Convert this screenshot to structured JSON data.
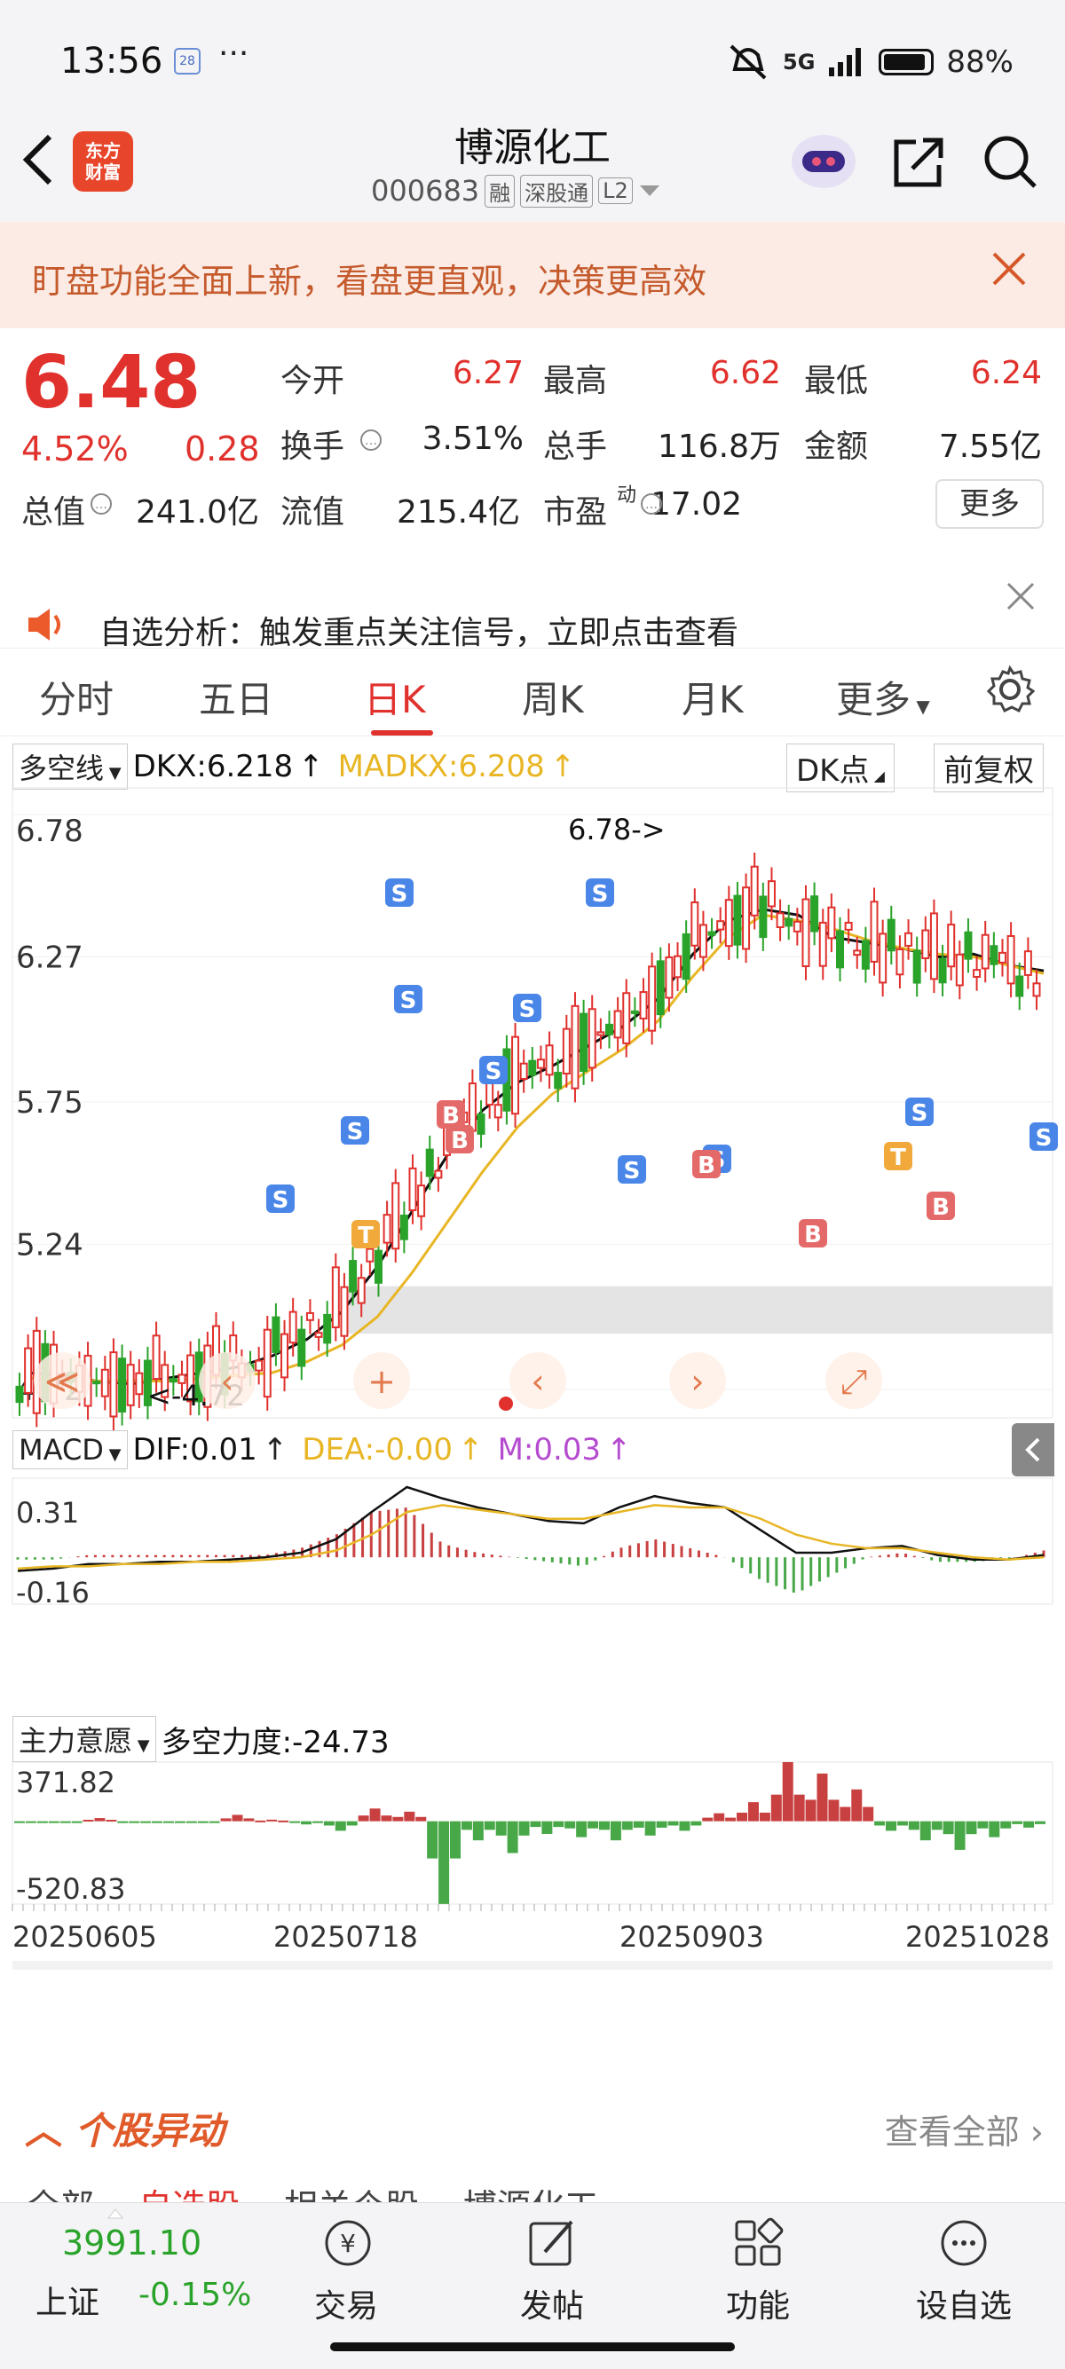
{
  "status_bar": {
    "time": "13:56",
    "notif": "28",
    "dots": "···",
    "network": "5G",
    "battery": "88%",
    "battery_level": 0.88
  },
  "header": {
    "stock_name": "博源化工",
    "stock_code": "000683",
    "tags": [
      "融",
      "深股通",
      "L2"
    ],
    "logo": "东方财富"
  },
  "banner": {
    "text": "盯盘功能全面上新，看盘更直观，决策更高效"
  },
  "quote": {
    "price": "6.48",
    "change_pct": "4.52%",
    "change": "0.28",
    "fields": [
      {
        "label": "今开",
        "value": "6.27",
        "color": "#e0312d"
      },
      {
        "label": "最高",
        "value": "6.62",
        "color": "#e0312d"
      },
      {
        "label": "最低",
        "value": "6.24",
        "color": "#e0312d"
      },
      {
        "label": "换手",
        "value": "3.51%",
        "color": "#222"
      },
      {
        "label": "总手",
        "value": "116.8万",
        "color": "#222"
      },
      {
        "label": "金额",
        "value": "7.55亿",
        "color": "#222"
      },
      {
        "label": "总值",
        "value": "241.0亿",
        "color": "#222"
      },
      {
        "label": "流值",
        "value": "215.4亿",
        "color": "#222"
      },
      {
        "label": "市盈",
        "value": "17.02",
        "color": "#222"
      }
    ],
    "pe_superscript": "动",
    "more": "更多"
  },
  "alert": {
    "text": "自选分析：触发重点关注信号，立即点击查看"
  },
  "tabs": [
    "分时",
    "五日",
    "日K",
    "周K",
    "月K",
    "更多"
  ],
  "active_tab": "日K",
  "kline_header": {
    "selector": "多空线",
    "dkx": "DKX:6.218",
    "madkx": "MADKX:6.208",
    "dk_point": "DK点",
    "adjust": "前复权"
  },
  "macd_header": {
    "selector": "MACD",
    "dif": "DIF:0.01",
    "dea": "DEA:-0.00",
    "m": "M:0.03"
  },
  "flow_header": {
    "selector": "主力意愿",
    "power": "多空力度:-24.73"
  },
  "chart_data": [
    {
      "type": "candlestick",
      "title": "日K",
      "y_ticks": [
        "6.78",
        "6.27",
        "5.75",
        "5.24",
        "4.72"
      ],
      "ylim": [
        4.72,
        6.78
      ],
      "annotations": [
        "6.78->",
        "<-4.72"
      ],
      "series": [
        {
          "name": "DKX",
          "color": "#111111",
          "values": [
            4.78,
            4.77,
            4.75,
            4.74,
            4.76,
            4.78,
            4.8,
            4.84,
            4.9,
            5.0,
            5.16,
            5.36,
            5.56,
            5.72,
            5.82,
            5.88,
            5.95,
            6.02,
            6.12,
            6.28,
            6.4,
            6.44,
            6.42,
            6.34,
            6.32,
            6.3,
            6.27,
            6.28,
            6.24,
            6.22
          ]
        },
        {
          "name": "MADKX",
          "color": "#e8b625",
          "values": [
            4.76,
            4.76,
            4.75,
            4.75,
            4.75,
            4.76,
            4.77,
            4.78,
            4.82,
            4.88,
            4.98,
            5.14,
            5.32,
            5.5,
            5.66,
            5.78,
            5.86,
            5.94,
            6.04,
            6.2,
            6.34,
            6.42,
            6.4,
            6.37,
            6.33,
            6.3,
            6.28,
            6.27,
            6.24,
            6.21
          ]
        }
      ]
    },
    {
      "type": "bar",
      "title": "MACD",
      "y_ticks": [
        "0.31",
        "-0.16"
      ],
      "ylim": [
        -0.16,
        0.31
      ],
      "series": [
        {
          "name": "DIF",
          "color": "#111111",
          "values": [
            -0.06,
            -0.05,
            -0.03,
            -0.03,
            -0.02,
            -0.02,
            -0.01,
            0.0,
            0.02,
            0.08,
            0.2,
            0.31,
            0.26,
            0.22,
            0.19,
            0.16,
            0.15,
            0.22,
            0.27,
            0.24,
            0.22,
            0.12,
            0.02,
            0.02,
            0.04,
            0.05,
            0.01,
            -0.01,
            -0.01,
            0.01
          ]
        },
        {
          "name": "DEA",
          "color": "#e8b625",
          "values": [
            -0.05,
            -0.04,
            -0.04,
            -0.03,
            -0.03,
            -0.02,
            -0.02,
            -0.01,
            0.0,
            0.03,
            0.1,
            0.2,
            0.23,
            0.21,
            0.19,
            0.17,
            0.17,
            0.2,
            0.23,
            0.22,
            0.22,
            0.17,
            0.1,
            0.06,
            0.04,
            0.04,
            0.02,
            0.0,
            -0.01,
            -0.0
          ]
        },
        {
          "name": "M",
          "values": [
            -0.01,
            -0.01,
            0.01,
            0.01,
            0.01,
            0.01,
            0.01,
            0.01,
            0.04,
            0.1,
            0.2,
            0.22,
            0.06,
            0.02,
            0.0,
            -0.02,
            -0.04,
            0.04,
            0.08,
            0.04,
            0.0,
            -0.1,
            -0.16,
            -0.08,
            0.0,
            0.02,
            -0.02,
            -0.02,
            -0.01,
            0.03
          ]
        }
      ]
    },
    {
      "type": "bar",
      "title": "主力意愿",
      "y_ticks": [
        "371.82",
        "-520.83"
      ],
      "ylim": [
        -520.83,
        371.82
      ],
      "values": [
        -10,
        -5,
        20,
        -10,
        -5,
        -10,
        40,
        10,
        -20,
        -60,
        80,
        60,
        -520,
        -120,
        -200,
        -80,
        -100,
        -120,
        -90,
        -60,
        50,
        120,
        372,
        300,
        200,
        -60,
        -120,
        -180,
        -100,
        -40
      ],
      "x_ticks": [
        "20250605",
        "20250718",
        "20250903",
        "20251028"
      ]
    }
  ],
  "stock_moves": {
    "title": "个股异动",
    "see_all": "查看全部",
    "sub_tabs": [
      "全部",
      "自选股",
      "相关个股",
      "博源化工"
    ]
  },
  "bottom_nav": {
    "index_value": "3991.10",
    "index_name": "上证",
    "index_change": "-0.15%",
    "items": [
      "交易",
      "发帖",
      "功能",
      "设自选"
    ]
  }
}
